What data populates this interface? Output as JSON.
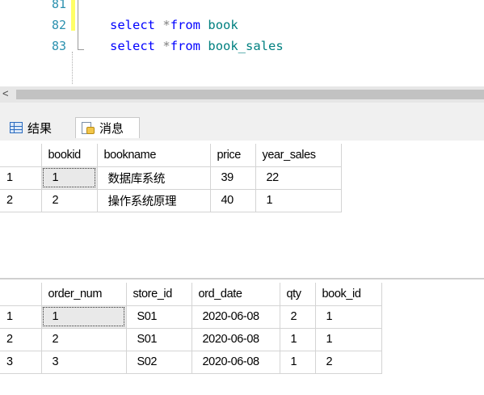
{
  "editor": {
    "lines": [
      {
        "number": "81",
        "code": ""
      },
      {
        "number": "82",
        "keyword1": "select",
        "op": "*",
        "keyword2": "from",
        "table": "book"
      },
      {
        "number": "83",
        "keyword1": "select",
        "op": "*",
        "keyword2": "from",
        "table": "book_sales"
      }
    ]
  },
  "tabs": {
    "results_label": "结果",
    "messages_label": "消息",
    "results_icon": "grid-icon",
    "messages_icon": "message-icon"
  },
  "result1": {
    "columns": [
      "bookid",
      "bookname",
      "price",
      "year_sales"
    ],
    "rows": [
      {
        "rownum": "1",
        "cells": [
          "1",
          "数据库系统",
          "39",
          "22"
        ]
      },
      {
        "rownum": "2",
        "cells": [
          "2",
          "操作系统原理",
          "40",
          "1"
        ]
      }
    ]
  },
  "result2": {
    "columns": [
      "order_num",
      "store_id",
      "ord_date",
      "qty",
      "book_id"
    ],
    "rows": [
      {
        "rownum": "1",
        "cells": [
          "1",
          "S01",
          "2020-06-08",
          "2",
          "1"
        ]
      },
      {
        "rownum": "2",
        "cells": [
          "2",
          "S01",
          "2020-06-08",
          "1",
          "1"
        ]
      },
      {
        "rownum": "3",
        "cells": [
          "3",
          "S02",
          "2020-06-08",
          "1",
          "2"
        ]
      }
    ]
  },
  "scrollbar": {
    "left_arrow": "<"
  }
}
